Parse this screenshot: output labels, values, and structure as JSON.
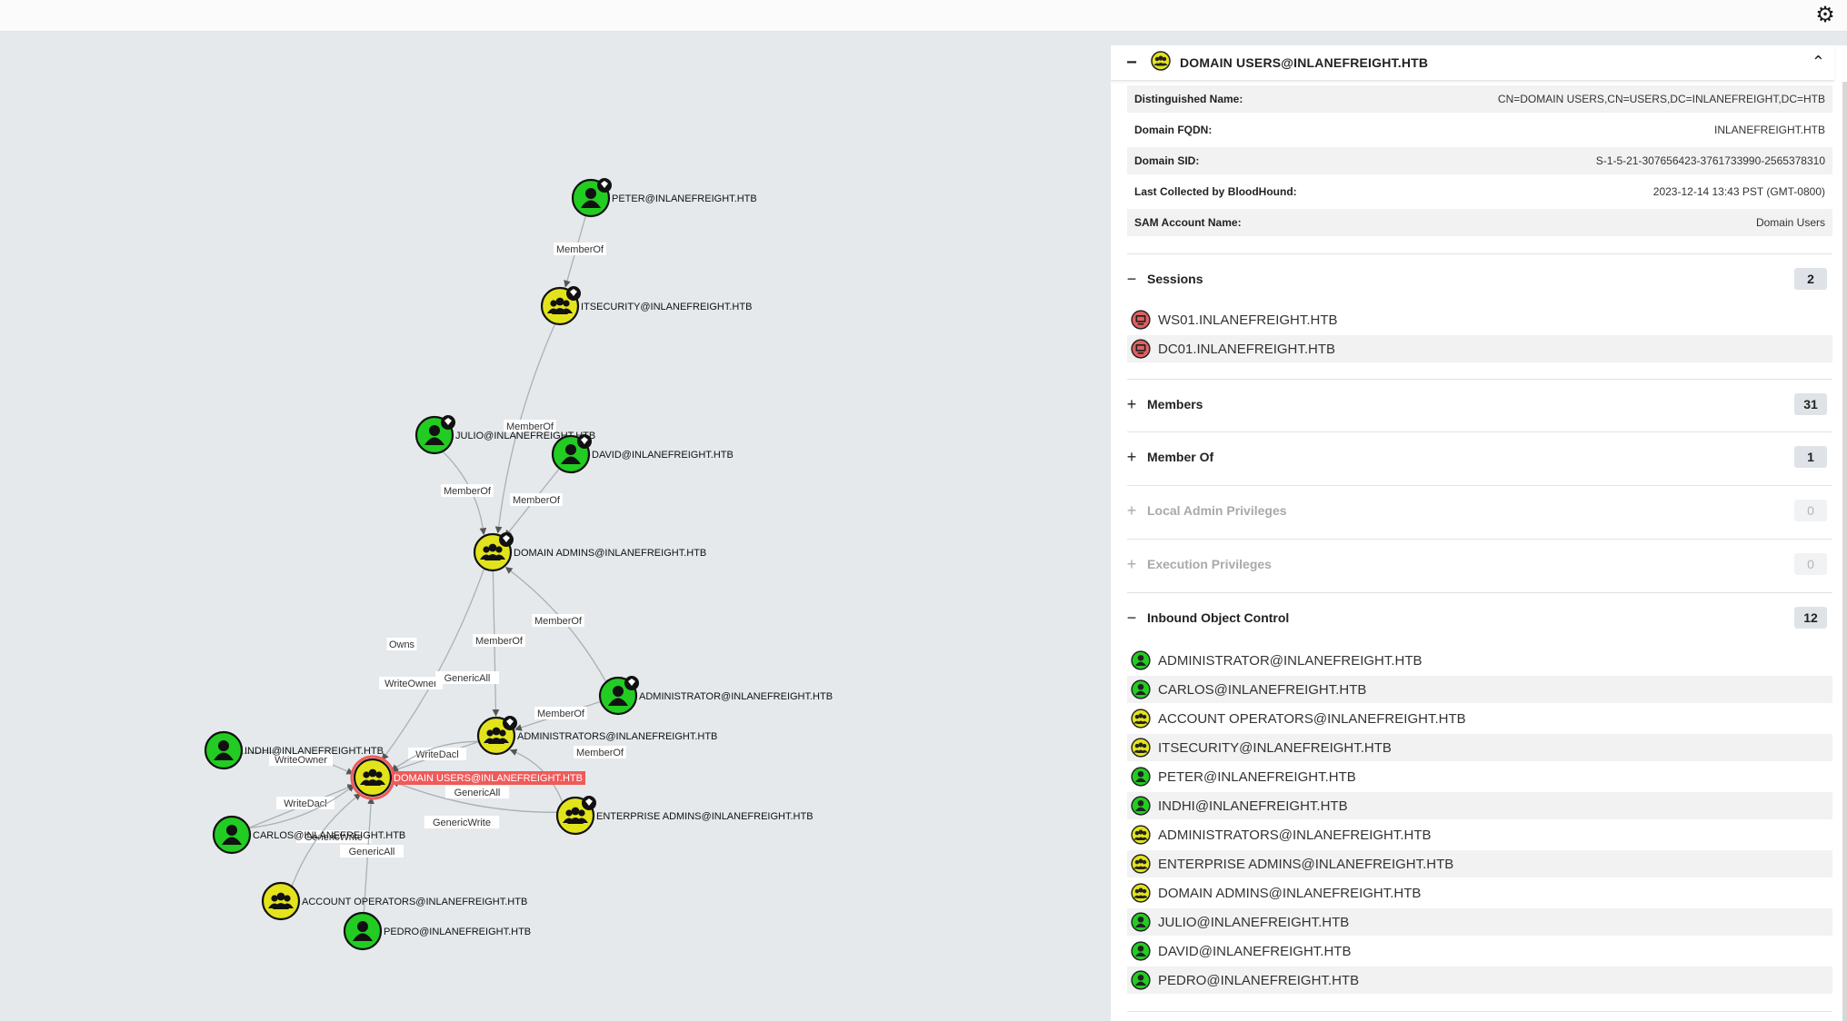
{
  "header": {
    "settings_icon": "gear-icon"
  },
  "graph": {
    "nodes": [
      {
        "id": "peter",
        "label": "PETER@INLANEFREIGHT.HTB",
        "type": "user",
        "owned": true
      },
      {
        "id": "itsec",
        "label": "ITSECURITY@INLANEFREIGHT.HTB",
        "type": "group",
        "owned": true
      },
      {
        "id": "julio",
        "label": "JULIO@INLANEFREIGHT.HTB",
        "type": "user",
        "owned": true
      },
      {
        "id": "david",
        "label": "DAVID@INLANEFREIGHT.HTB",
        "type": "user",
        "owned": true
      },
      {
        "id": "dadmins",
        "label": "DOMAIN ADMINS@INLANEFREIGHT.HTB",
        "type": "group",
        "owned": true
      },
      {
        "id": "admin",
        "label": "ADMINISTRATOR@INLANEFREIGHT.HTB",
        "type": "user",
        "owned": true
      },
      {
        "id": "admins",
        "label": "ADMINISTRATORS@INLANEFREIGHT.HTB",
        "type": "group",
        "owned": true
      },
      {
        "id": "indhi",
        "label": "INDHI@INLANEFREIGHT.HTB",
        "type": "user",
        "owned": false
      },
      {
        "id": "dusers",
        "label": "DOMAIN USERS@INLANEFREIGHT.HTB",
        "type": "group",
        "owned": false,
        "selected": true
      },
      {
        "id": "eadmins",
        "label": "ENTERPRISE ADMINS@INLANEFREIGHT.HTB",
        "type": "group",
        "owned": true
      },
      {
        "id": "carlos",
        "label": "CARLOS@INLANEFREIGHT.HTB",
        "type": "user",
        "owned": false
      },
      {
        "id": "accops",
        "label": "ACCOUNT OPERATORS@INLANEFREIGHT.HTB",
        "type": "group",
        "owned": false
      },
      {
        "id": "pedro",
        "label": "PEDRO@INLANEFREIGHT.HTB",
        "type": "user",
        "owned": false
      }
    ],
    "edges": [
      {
        "from": "peter",
        "to": "itsec",
        "label": "MemberOf"
      },
      {
        "from": "itsec",
        "to": "dadmins",
        "label": "MemberOf"
      },
      {
        "from": "julio",
        "to": "dadmins",
        "label": "MemberOf"
      },
      {
        "from": "david",
        "to": "dadmins",
        "label": "MemberOf"
      },
      {
        "from": "admin",
        "to": "dadmins",
        "label": "MemberOf"
      },
      {
        "from": "dadmins",
        "to": "dusers",
        "label": "Owns"
      },
      {
        "from": "dadmins",
        "to": "admins",
        "label": "MemberOf"
      },
      {
        "from": "admins",
        "to": "dusers",
        "label": "WriteOwner"
      },
      {
        "from": "eadmins",
        "to": "dusers",
        "label": "GenericAll"
      },
      {
        "from": "admin",
        "to": "admins",
        "label": "MemberOf"
      },
      {
        "from": "eadmins",
        "to": "admins",
        "label": "MemberOf"
      },
      {
        "from": "indhi",
        "to": "dusers",
        "label": "WriteOwner"
      },
      {
        "from": "admins",
        "to": "dusers",
        "label": "WriteDacl"
      },
      {
        "from": "admins",
        "to": "dusers",
        "label": "GenericAll"
      },
      {
        "from": "eadmins",
        "to": "dusers",
        "label": "GenericWrite"
      },
      {
        "from": "carlos",
        "to": "dusers",
        "label": "WriteDacl"
      },
      {
        "from": "carlos",
        "to": "dusers",
        "label": "GenericWrite"
      },
      {
        "from": "accops",
        "to": "dusers",
        "label": "GenericAll"
      },
      {
        "from": "pedro",
        "to": "dusers",
        "label": "GenericAll"
      }
    ]
  },
  "panel": {
    "title": "DOMAIN USERS@INLANEFREIGHT.HTB",
    "properties": [
      {
        "key": "Distinguished Name:",
        "value": "CN=DOMAIN USERS,CN=USERS,DC=INLANEFREIGHT,DC=HTB"
      },
      {
        "key": "Domain FQDN:",
        "value": "INLANEFREIGHT.HTB"
      },
      {
        "key": "Domain SID:",
        "value": "S-1-5-21-307656423-3761733990-2565378310"
      },
      {
        "key": "Last Collected by BloodHound:",
        "value": "2023-12-14 13:43 PST (GMT-0800)"
      },
      {
        "key": "SAM Account Name:",
        "value": "Domain Users"
      }
    ],
    "sessions": {
      "toggle": "−",
      "label": "Sessions",
      "count": "2",
      "items": [
        "WS01.INLANEFREIGHT.HTB",
        "DC01.INLANEFREIGHT.HTB"
      ]
    },
    "members": {
      "toggle": "+",
      "label": "Members",
      "count": "31"
    },
    "member_of": {
      "toggle": "+",
      "label": "Member Of",
      "count": "1"
    },
    "local_admin": {
      "toggle": "+",
      "label": "Local Admin Privileges",
      "count": "0"
    },
    "execution": {
      "toggle": "+",
      "label": "Execution Privileges",
      "count": "0"
    },
    "inbound": {
      "toggle": "−",
      "label": "Inbound Object Control",
      "count": "12",
      "items": [
        {
          "name": "ADMINISTRATOR@INLANEFREIGHT.HTB",
          "type": "user"
        },
        {
          "name": "CARLOS@INLANEFREIGHT.HTB",
          "type": "user"
        },
        {
          "name": "ACCOUNT OPERATORS@INLANEFREIGHT.HTB",
          "type": "group"
        },
        {
          "name": "ITSECURITY@INLANEFREIGHT.HTB",
          "type": "group"
        },
        {
          "name": "PETER@INLANEFREIGHT.HTB",
          "type": "user"
        },
        {
          "name": "INDHI@INLANEFREIGHT.HTB",
          "type": "user"
        },
        {
          "name": "ADMINISTRATORS@INLANEFREIGHT.HTB",
          "type": "group"
        },
        {
          "name": "ENTERPRISE ADMINS@INLANEFREIGHT.HTB",
          "type": "group"
        },
        {
          "name": "DOMAIN ADMINS@INLANEFREIGHT.HTB",
          "type": "group"
        },
        {
          "name": "JULIO@INLANEFREIGHT.HTB",
          "type": "user"
        },
        {
          "name": "DAVID@INLANEFREIGHT.HTB",
          "type": "user"
        },
        {
          "name": "PEDRO@INLANEFREIGHT.HTB",
          "type": "user"
        }
      ]
    }
  },
  "colors": {
    "user_node": "#22cc22",
    "group_node": "#e3e31c",
    "computer_node": "#e06060",
    "selected_label_bg": "#f05a5a",
    "edge": "#aab0b5"
  }
}
